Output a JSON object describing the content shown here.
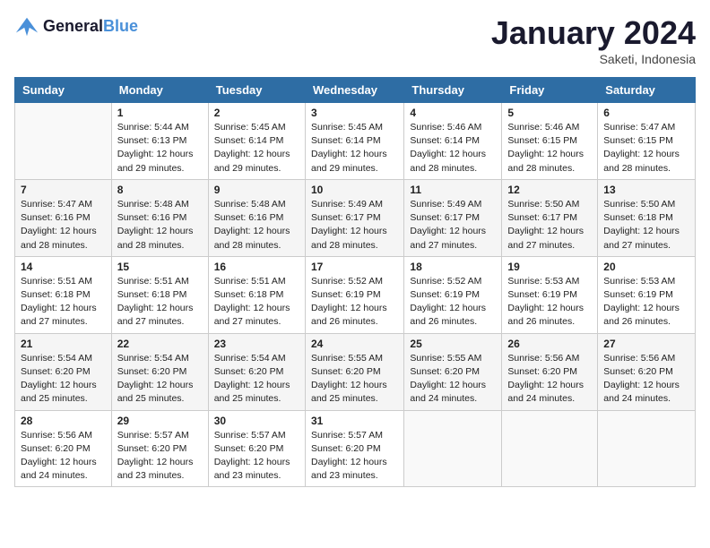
{
  "logo": {
    "line1": "General",
    "line2": "Blue"
  },
  "title": "January 2024",
  "location": "Saketi, Indonesia",
  "weekdays": [
    "Sunday",
    "Monday",
    "Tuesday",
    "Wednesday",
    "Thursday",
    "Friday",
    "Saturday"
  ],
  "weeks": [
    [
      {
        "day": "",
        "info": ""
      },
      {
        "day": "1",
        "info": "Sunrise: 5:44 AM\nSunset: 6:13 PM\nDaylight: 12 hours\nand 29 minutes."
      },
      {
        "day": "2",
        "info": "Sunrise: 5:45 AM\nSunset: 6:14 PM\nDaylight: 12 hours\nand 29 minutes."
      },
      {
        "day": "3",
        "info": "Sunrise: 5:45 AM\nSunset: 6:14 PM\nDaylight: 12 hours\nand 29 minutes."
      },
      {
        "day": "4",
        "info": "Sunrise: 5:46 AM\nSunset: 6:14 PM\nDaylight: 12 hours\nand 28 minutes."
      },
      {
        "day": "5",
        "info": "Sunrise: 5:46 AM\nSunset: 6:15 PM\nDaylight: 12 hours\nand 28 minutes."
      },
      {
        "day": "6",
        "info": "Sunrise: 5:47 AM\nSunset: 6:15 PM\nDaylight: 12 hours\nand 28 minutes."
      }
    ],
    [
      {
        "day": "7",
        "info": "Sunrise: 5:47 AM\nSunset: 6:16 PM\nDaylight: 12 hours\nand 28 minutes."
      },
      {
        "day": "8",
        "info": "Sunrise: 5:48 AM\nSunset: 6:16 PM\nDaylight: 12 hours\nand 28 minutes."
      },
      {
        "day": "9",
        "info": "Sunrise: 5:48 AM\nSunset: 6:16 PM\nDaylight: 12 hours\nand 28 minutes."
      },
      {
        "day": "10",
        "info": "Sunrise: 5:49 AM\nSunset: 6:17 PM\nDaylight: 12 hours\nand 28 minutes."
      },
      {
        "day": "11",
        "info": "Sunrise: 5:49 AM\nSunset: 6:17 PM\nDaylight: 12 hours\nand 27 minutes."
      },
      {
        "day": "12",
        "info": "Sunrise: 5:50 AM\nSunset: 6:17 PM\nDaylight: 12 hours\nand 27 minutes."
      },
      {
        "day": "13",
        "info": "Sunrise: 5:50 AM\nSunset: 6:18 PM\nDaylight: 12 hours\nand 27 minutes."
      }
    ],
    [
      {
        "day": "14",
        "info": "Sunrise: 5:51 AM\nSunset: 6:18 PM\nDaylight: 12 hours\nand 27 minutes."
      },
      {
        "day": "15",
        "info": "Sunrise: 5:51 AM\nSunset: 6:18 PM\nDaylight: 12 hours\nand 27 minutes."
      },
      {
        "day": "16",
        "info": "Sunrise: 5:51 AM\nSunset: 6:18 PM\nDaylight: 12 hours\nand 27 minutes."
      },
      {
        "day": "17",
        "info": "Sunrise: 5:52 AM\nSunset: 6:19 PM\nDaylight: 12 hours\nand 26 minutes."
      },
      {
        "day": "18",
        "info": "Sunrise: 5:52 AM\nSunset: 6:19 PM\nDaylight: 12 hours\nand 26 minutes."
      },
      {
        "day": "19",
        "info": "Sunrise: 5:53 AM\nSunset: 6:19 PM\nDaylight: 12 hours\nand 26 minutes."
      },
      {
        "day": "20",
        "info": "Sunrise: 5:53 AM\nSunset: 6:19 PM\nDaylight: 12 hours\nand 26 minutes."
      }
    ],
    [
      {
        "day": "21",
        "info": "Sunrise: 5:54 AM\nSunset: 6:20 PM\nDaylight: 12 hours\nand 25 minutes."
      },
      {
        "day": "22",
        "info": "Sunrise: 5:54 AM\nSunset: 6:20 PM\nDaylight: 12 hours\nand 25 minutes."
      },
      {
        "day": "23",
        "info": "Sunrise: 5:54 AM\nSunset: 6:20 PM\nDaylight: 12 hours\nand 25 minutes."
      },
      {
        "day": "24",
        "info": "Sunrise: 5:55 AM\nSunset: 6:20 PM\nDaylight: 12 hours\nand 25 minutes."
      },
      {
        "day": "25",
        "info": "Sunrise: 5:55 AM\nSunset: 6:20 PM\nDaylight: 12 hours\nand 24 minutes."
      },
      {
        "day": "26",
        "info": "Sunrise: 5:56 AM\nSunset: 6:20 PM\nDaylight: 12 hours\nand 24 minutes."
      },
      {
        "day": "27",
        "info": "Sunrise: 5:56 AM\nSunset: 6:20 PM\nDaylight: 12 hours\nand 24 minutes."
      }
    ],
    [
      {
        "day": "28",
        "info": "Sunrise: 5:56 AM\nSunset: 6:20 PM\nDaylight: 12 hours\nand 24 minutes."
      },
      {
        "day": "29",
        "info": "Sunrise: 5:57 AM\nSunset: 6:20 PM\nDaylight: 12 hours\nand 23 minutes."
      },
      {
        "day": "30",
        "info": "Sunrise: 5:57 AM\nSunset: 6:20 PM\nDaylight: 12 hours\nand 23 minutes."
      },
      {
        "day": "31",
        "info": "Sunrise: 5:57 AM\nSunset: 6:20 PM\nDaylight: 12 hours\nand 23 minutes."
      },
      {
        "day": "",
        "info": ""
      },
      {
        "day": "",
        "info": ""
      },
      {
        "day": "",
        "info": ""
      }
    ]
  ]
}
